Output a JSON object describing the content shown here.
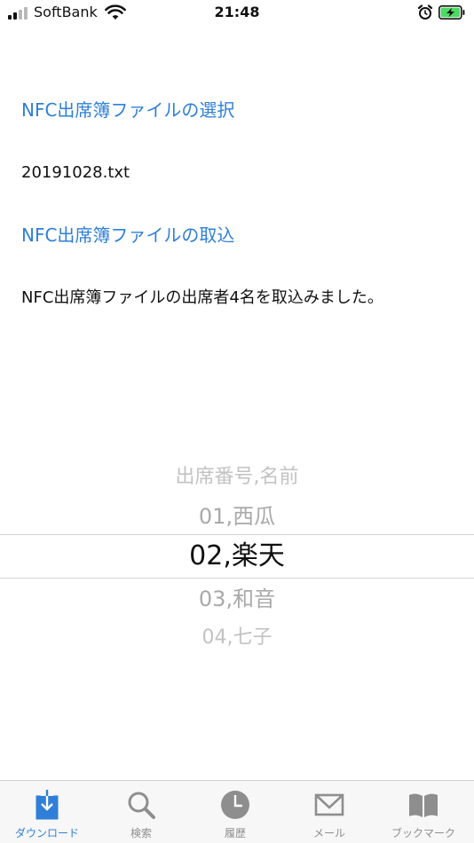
{
  "status_bar": {
    "carrier": "SoftBank",
    "time": "21:48"
  },
  "content": {
    "select_file_link": "NFC出席簿ファイルの選択",
    "selected_file": "20191028.txt",
    "import_link": "NFC出席簿ファイルの取込",
    "import_result": "NFC出席簿ファイルの出席者4名を取込みました。"
  },
  "picker": {
    "rows": [
      "出席番号,名前",
      "01,西瓜",
      "02,楽天",
      "03,和音",
      "04,七子"
    ],
    "selected_index": 2
  },
  "tab_bar": {
    "items": [
      {
        "label": "ダウンロード",
        "icon": "download-icon",
        "active": true
      },
      {
        "label": "検索",
        "icon": "search-icon",
        "active": false
      },
      {
        "label": "履歴",
        "icon": "clock-icon",
        "active": false
      },
      {
        "label": "メール",
        "icon": "mail-icon",
        "active": false
      },
      {
        "label": "ブックマーク",
        "icon": "bookmark-icon",
        "active": false
      }
    ]
  },
  "colors": {
    "accent": "#2f7fd8",
    "inactive": "#8e8e8e",
    "battery": "#4cd964"
  }
}
